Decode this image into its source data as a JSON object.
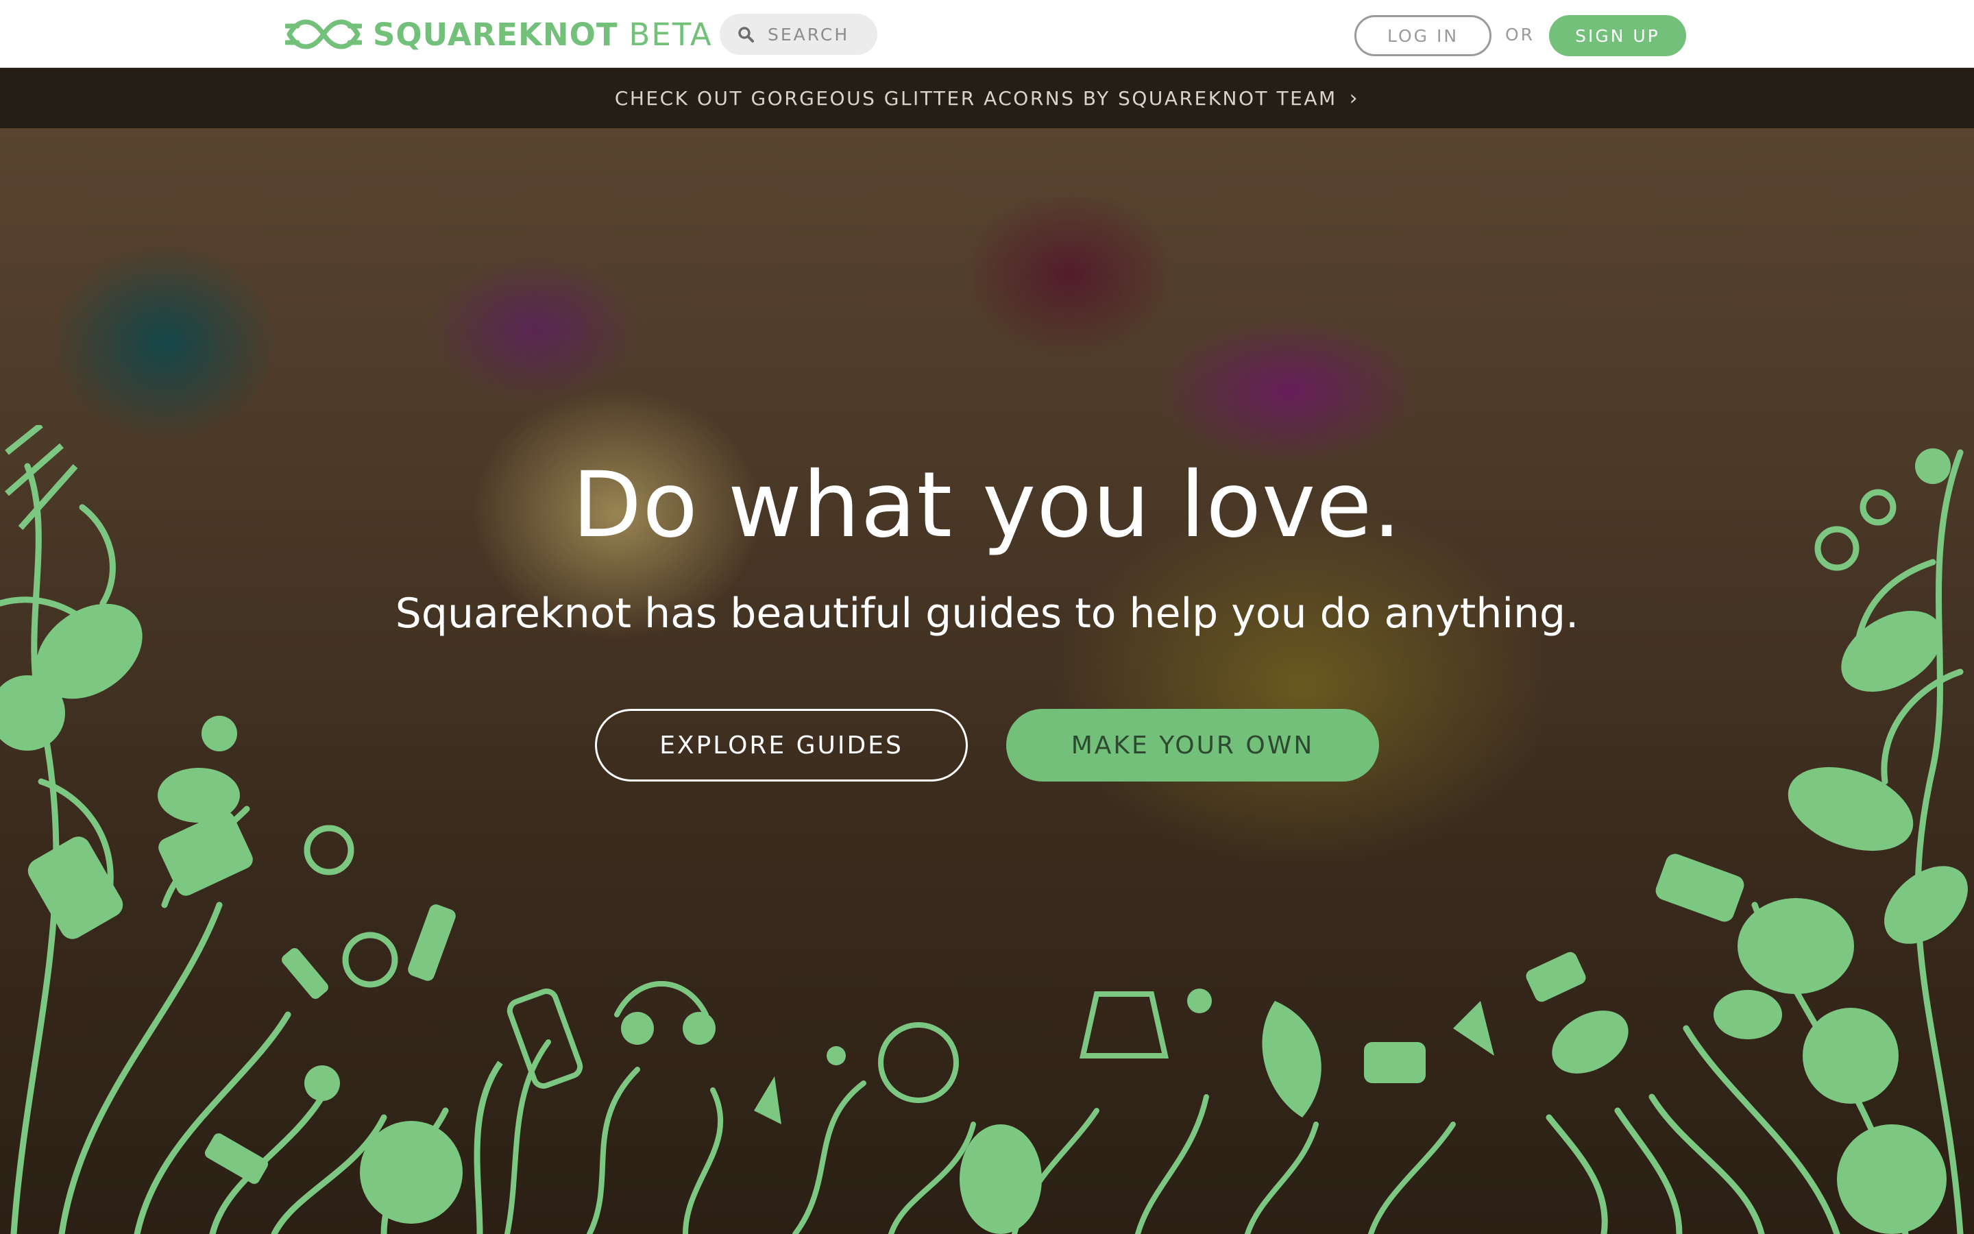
{
  "header": {
    "logo_name": "SQUAREKNOT",
    "logo_beta": "BETA",
    "search_placeholder": "SEARCH",
    "login_label": "LOG IN",
    "or_label": "OR",
    "signup_label": "SIGN UP"
  },
  "announcement": {
    "text": "CHECK OUT GORGEOUS GLITTER ACORNS BY SQUAREKNOT TEAM",
    "chevron": "›"
  },
  "hero": {
    "title": "Do what you love.",
    "subtitle": "Squareknot has beautiful guides to help you do anything.",
    "explore_label": "EXPLORE GUIDES",
    "make_label": "MAKE YOUR OWN"
  },
  "colors": {
    "brand_green": "#73c07b",
    "header_bg": "#ffffff",
    "announce_bg": "#19160f",
    "hero_text": "#ffffff"
  },
  "icons": [
    "squareknot-logo-icon",
    "search-icon",
    "chevron-right-icon"
  ]
}
